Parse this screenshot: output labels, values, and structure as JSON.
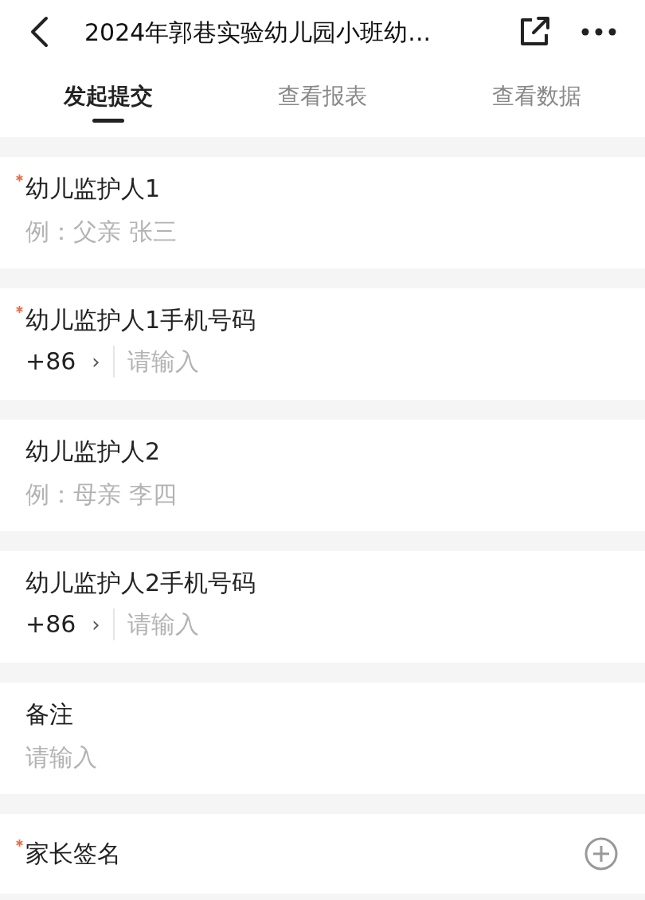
{
  "header": {
    "title": "2024年郭巷实验幼儿园小班幼..."
  },
  "tabs": [
    {
      "label": "发起提交",
      "selected": true
    },
    {
      "label": "查看报表",
      "selected": false
    },
    {
      "label": "查看数据",
      "selected": false
    }
  ],
  "fields": [
    {
      "kind": "text",
      "label": "幼儿监护人1",
      "required": true,
      "placeholder": "例：父亲 张三"
    },
    {
      "kind": "phone",
      "label": "幼儿监护人1手机号码",
      "required": true,
      "code": "+86",
      "chevron": "›",
      "placeholder": "请输入"
    },
    {
      "kind": "text",
      "label": "幼儿监护人2",
      "required": false,
      "placeholder": "例：母亲 李四"
    },
    {
      "kind": "phone",
      "label": "幼儿监护人2手机号码",
      "required": false,
      "code": "+86",
      "chevron": "›",
      "placeholder": "请输入"
    },
    {
      "kind": "text",
      "label": "备注",
      "required": false,
      "placeholder": "请输入"
    },
    {
      "kind": "signature",
      "label": "家长签名",
      "required": true
    }
  ]
}
